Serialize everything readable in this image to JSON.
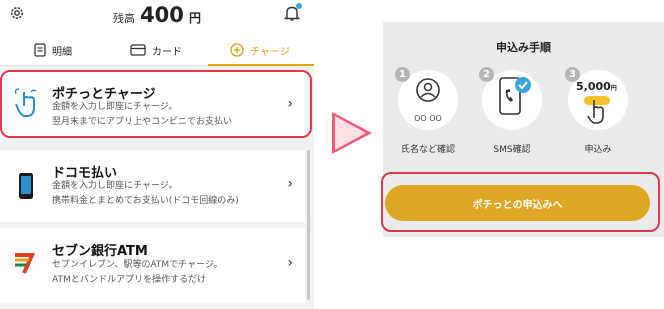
{
  "header": {
    "balance_label": "残高",
    "balance_amount": "400",
    "balance_unit": "円"
  },
  "tabs": [
    {
      "label": "明細",
      "icon": "document-icon"
    },
    {
      "label": "カード",
      "icon": "card-icon"
    },
    {
      "label": "チャージ",
      "icon": "plus-circle-icon",
      "active": true
    }
  ],
  "charge_methods": [
    {
      "title": "ポチっとチャージ",
      "desc1": "金額を入力し即座にチャージ。",
      "desc2": "翌月末までにアプリ上やコンビニでお支払い",
      "icon": "tap-icon"
    },
    {
      "title": "ドコモ払い",
      "desc1": "金額を入力し即座にチャージ。",
      "desc2": "携帯料金とまとめてお支払い(ドコモ回線のみ)",
      "icon": "smartphone-icon"
    },
    {
      "title": "セブン銀行ATM",
      "desc1": "セブンイレブン、駅等のATMでチャージ。",
      "desc2": "ATMとバンドルアプリを操作するだけ",
      "icon": "seven-bank-icon"
    }
  ],
  "procedure": {
    "heading": "申込み手順",
    "steps": [
      {
        "num": "1",
        "caption": "氏名など確認",
        "icon": "person-icon",
        "extra": "OO OO"
      },
      {
        "num": "2",
        "caption": "SMS確認",
        "icon": "phone-check-icon"
      },
      {
        "num": "3",
        "caption": "申込み",
        "icon": "tap-amount-icon",
        "extra": "5,000",
        "extra_unit": "円"
      }
    ],
    "button_label": "ポチっとの申込みへ"
  },
  "colors": {
    "accent": "#dea826",
    "highlight": "#e03a4a",
    "arrow": "#ef5b7a"
  }
}
